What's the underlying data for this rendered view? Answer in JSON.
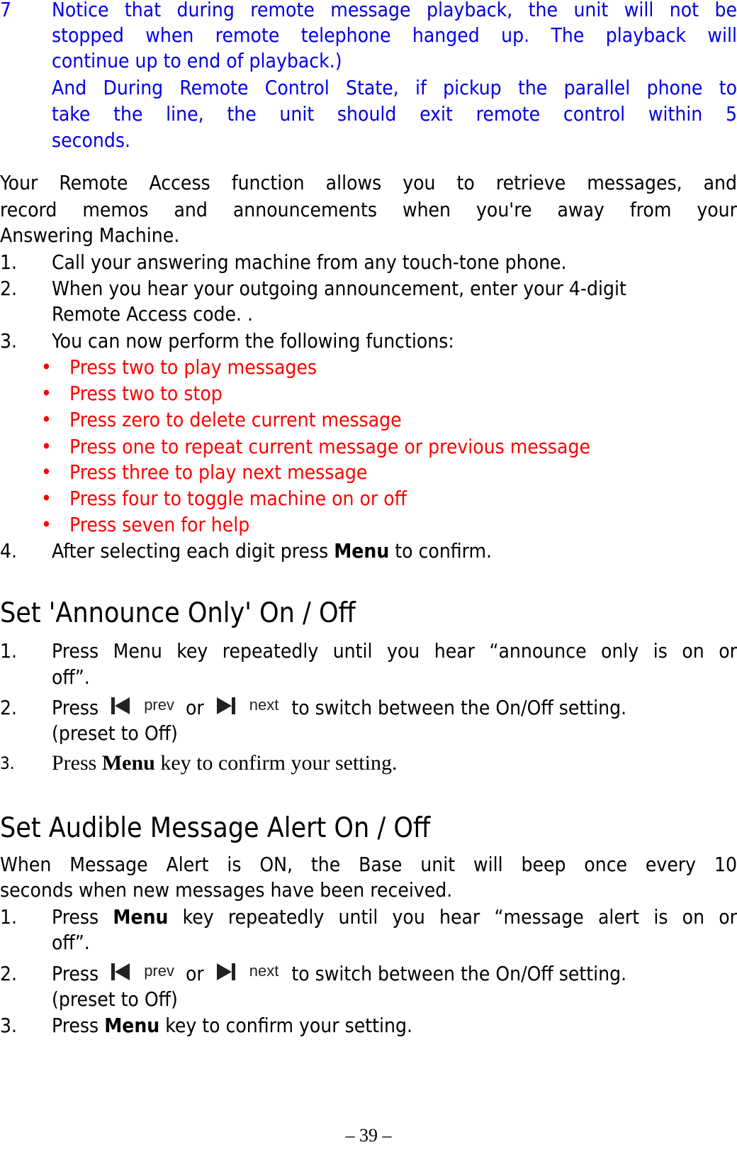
{
  "note": {
    "number": "7",
    "line1": "Notice that during remote message playback, the unit will not be",
    "line2": "stopped when remote telephone hanged up. The playback will",
    "line3": "continue up to end of playback.)",
    "line4": "And During Remote Control State, if pickup the parallel phone to",
    "line5": "take the line, the unit should exit remote control within 5",
    "line6": "seconds.",
    "color": "#0000e6"
  },
  "intro": {
    "line1": "Your Remote Access function allows you to retrieve messages, and",
    "line2": "record memos and announcements when you're away from your",
    "line3": "Answering Machine."
  },
  "steps": [
    {
      "num": "1.",
      "text": "Call your answering machine from any touch-tone phone."
    },
    {
      "num": "2.",
      "text": "When you hear your outgoing announcement, enter your 4-digit",
      "cont": "Remote Access code. ."
    },
    {
      "num": "3.",
      "text": "You can now perform the following functions:"
    },
    {
      "num": "4.",
      "pre": "After selecting each digit press ",
      "bold": "Menu",
      "post": " to confirm."
    }
  ],
  "functions": {
    "color": "#ff0000",
    "bullet": "•",
    "items": [
      "Press two to play messages",
      "Press two to stop",
      "Press zero to delete current message",
      "Press one to repeat current message or previous message",
      "Press three to play next message",
      "Press four to toggle machine on or off",
      "Press seven for help"
    ]
  },
  "announce_only": {
    "heading": "Set 'Announce Only' On / Off",
    "step1": {
      "num": "1.",
      "text": "Press Menu key repeatedly until you hear “announce only is on or",
      "cont": "off”."
    },
    "step2": {
      "num": "2.",
      "press": "Press",
      "prev_label": "prev",
      "or": "or",
      "next_label": "next",
      "post": "to switch between the On/Off setting.",
      "cont": "(preset to Off)"
    },
    "step3": {
      "num": "3.",
      "pre": "Press ",
      "bold": "Menu",
      "post": " key to confirm your setting."
    }
  },
  "message_alert": {
    "heading": "Set Audible Message Alert On / Off",
    "desc1": "When Message Alert is ON, the Base unit will beep once every 10",
    "desc2": "seconds when new messages have been received.",
    "step1": {
      "num": "1.",
      "pre": "Press ",
      "bold": "Menu",
      "post": " key repeatedly until you hear “message alert is on or",
      "cont": "off”."
    },
    "step2": {
      "num": "2.",
      "press": "Press",
      "prev_label": "prev",
      "or": "or",
      "next_label": "next",
      "post": "to switch between the On/Off setting.",
      "cont": "(preset to Off)"
    },
    "step3": {
      "num": "3.",
      "pre": "Press ",
      "bold": "Menu",
      "post": " key to confirm your setting."
    }
  },
  "footer": {
    "page_number": "– 39 –"
  }
}
